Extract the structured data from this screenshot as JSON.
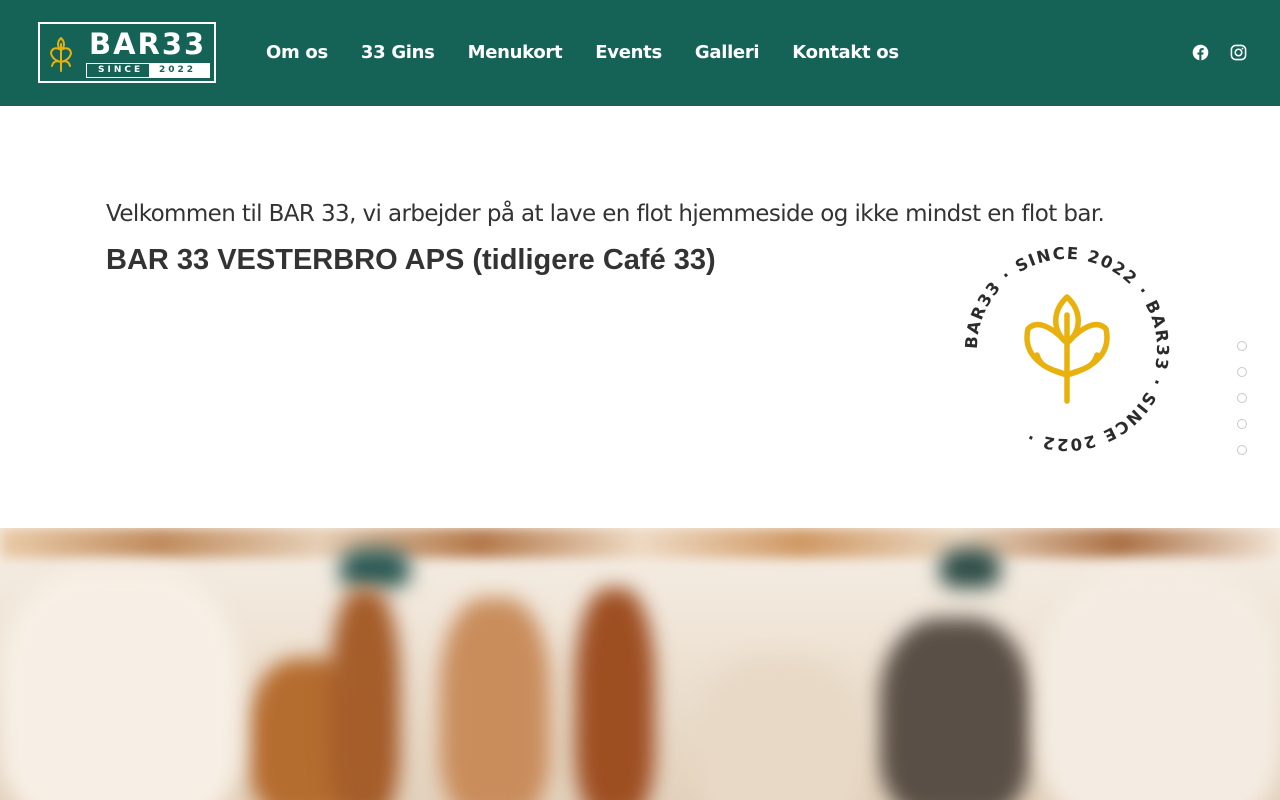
{
  "brand": {
    "name": "BAR33",
    "since": "SINCE",
    "year": "2022",
    "colors": {
      "header_bg": "#156357",
      "accent_gold": "#E8B10D",
      "text": "#333333"
    }
  },
  "nav": {
    "items": [
      {
        "label": "Om os"
      },
      {
        "label": "33 Gins"
      },
      {
        "label": "Menukort"
      },
      {
        "label": "Events"
      },
      {
        "label": "Galleri"
      },
      {
        "label": "Kontakt os"
      }
    ]
  },
  "social": [
    {
      "icon": "facebook-icon"
    },
    {
      "icon": "instagram-icon"
    }
  ],
  "main": {
    "welcome": "Velkommen til BAR 33, vi arbejder på at lave en flot hjemmeside og ikke mindst en flot bar.",
    "company": "BAR 33 VESTERBRO APS (tidligere Café 33)",
    "badge_ring_text": "BAR33 · SINCE 2022 · BAR33 · SINCE 2022 · "
  },
  "page_dots": {
    "count": 5
  }
}
